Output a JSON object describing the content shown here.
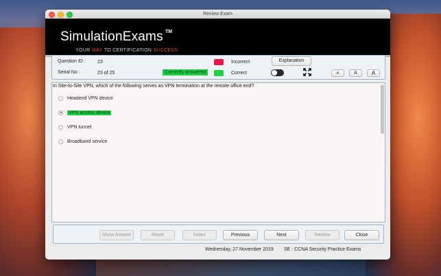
{
  "window": {
    "title": "Review Exam"
  },
  "banner": {
    "brand": "SimulationExams",
    "trademark": "TM",
    "tagline_your": "YOUR",
    "tagline_way": "WAY",
    "tagline_to": "TO CERTIFICATION",
    "tagline_success": "SUCCESS"
  },
  "info": {
    "question_id_label": "Question ID :",
    "question_id_value": "23",
    "serial_label": "Serial No :",
    "serial_value": "23 of 25",
    "status_pill": "Correctly answered",
    "incorrect_label": "Incorrect",
    "correct_label": "Correct",
    "explanation_button": "Explanation",
    "font_buttons": [
      "A",
      "A",
      "A"
    ],
    "colors": {
      "incorrect": "#e8174b",
      "correct": "#1fcf45"
    }
  },
  "question": {
    "text": "In Site-to-Site VPN, which of the following serves as VPN termination at the remote office end?",
    "options": [
      {
        "label": "Headend VPN device",
        "selected": false
      },
      {
        "label": "VPN access device",
        "selected": true
      },
      {
        "label": "VPN tunnel",
        "selected": false
      },
      {
        "label": "Broadband service",
        "selected": false
      }
    ]
  },
  "nav": {
    "show_answer": "Show Answer",
    "reset": "Reset",
    "notes": "Notes",
    "previous": "Previous",
    "next": "Next",
    "review": "Review",
    "close": "Close"
  },
  "footer": {
    "date": "Wednesday, 27 November 2019",
    "exam": "SE : CCNA Security Practice Exams"
  }
}
